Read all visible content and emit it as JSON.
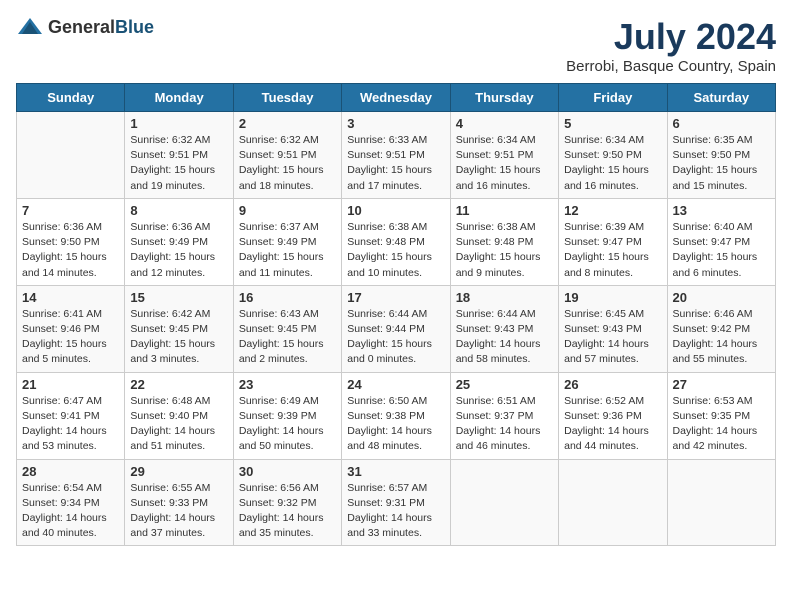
{
  "logo": {
    "general": "General",
    "blue": "Blue"
  },
  "title": "July 2024",
  "location": "Berrobi, Basque Country, Spain",
  "days_header": [
    "Sunday",
    "Monday",
    "Tuesday",
    "Wednesday",
    "Thursday",
    "Friday",
    "Saturday"
  ],
  "weeks": [
    [
      {
        "day": "",
        "info": ""
      },
      {
        "day": "1",
        "info": "Sunrise: 6:32 AM\nSunset: 9:51 PM\nDaylight: 15 hours and 19 minutes."
      },
      {
        "day": "2",
        "info": "Sunrise: 6:32 AM\nSunset: 9:51 PM\nDaylight: 15 hours and 18 minutes."
      },
      {
        "day": "3",
        "info": "Sunrise: 6:33 AM\nSunset: 9:51 PM\nDaylight: 15 hours and 17 minutes."
      },
      {
        "day": "4",
        "info": "Sunrise: 6:34 AM\nSunset: 9:51 PM\nDaylight: 15 hours and 16 minutes."
      },
      {
        "day": "5",
        "info": "Sunrise: 6:34 AM\nSunset: 9:50 PM\nDaylight: 15 hours and 16 minutes."
      },
      {
        "day": "6",
        "info": "Sunrise: 6:35 AM\nSunset: 9:50 PM\nDaylight: 15 hours and 15 minutes."
      }
    ],
    [
      {
        "day": "7",
        "info": "Sunrise: 6:36 AM\nSunset: 9:50 PM\nDaylight: 15 hours and 14 minutes."
      },
      {
        "day": "8",
        "info": "Sunrise: 6:36 AM\nSunset: 9:49 PM\nDaylight: 15 hours and 12 minutes."
      },
      {
        "day": "9",
        "info": "Sunrise: 6:37 AM\nSunset: 9:49 PM\nDaylight: 15 hours and 11 minutes."
      },
      {
        "day": "10",
        "info": "Sunrise: 6:38 AM\nSunset: 9:48 PM\nDaylight: 15 hours and 10 minutes."
      },
      {
        "day": "11",
        "info": "Sunrise: 6:38 AM\nSunset: 9:48 PM\nDaylight: 15 hours and 9 minutes."
      },
      {
        "day": "12",
        "info": "Sunrise: 6:39 AM\nSunset: 9:47 PM\nDaylight: 15 hours and 8 minutes."
      },
      {
        "day": "13",
        "info": "Sunrise: 6:40 AM\nSunset: 9:47 PM\nDaylight: 15 hours and 6 minutes."
      }
    ],
    [
      {
        "day": "14",
        "info": "Sunrise: 6:41 AM\nSunset: 9:46 PM\nDaylight: 15 hours and 5 minutes."
      },
      {
        "day": "15",
        "info": "Sunrise: 6:42 AM\nSunset: 9:45 PM\nDaylight: 15 hours and 3 minutes."
      },
      {
        "day": "16",
        "info": "Sunrise: 6:43 AM\nSunset: 9:45 PM\nDaylight: 15 hours and 2 minutes."
      },
      {
        "day": "17",
        "info": "Sunrise: 6:44 AM\nSunset: 9:44 PM\nDaylight: 15 hours and 0 minutes."
      },
      {
        "day": "18",
        "info": "Sunrise: 6:44 AM\nSunset: 9:43 PM\nDaylight: 14 hours and 58 minutes."
      },
      {
        "day": "19",
        "info": "Sunrise: 6:45 AM\nSunset: 9:43 PM\nDaylight: 14 hours and 57 minutes."
      },
      {
        "day": "20",
        "info": "Sunrise: 6:46 AM\nSunset: 9:42 PM\nDaylight: 14 hours and 55 minutes."
      }
    ],
    [
      {
        "day": "21",
        "info": "Sunrise: 6:47 AM\nSunset: 9:41 PM\nDaylight: 14 hours and 53 minutes."
      },
      {
        "day": "22",
        "info": "Sunrise: 6:48 AM\nSunset: 9:40 PM\nDaylight: 14 hours and 51 minutes."
      },
      {
        "day": "23",
        "info": "Sunrise: 6:49 AM\nSunset: 9:39 PM\nDaylight: 14 hours and 50 minutes."
      },
      {
        "day": "24",
        "info": "Sunrise: 6:50 AM\nSunset: 9:38 PM\nDaylight: 14 hours and 48 minutes."
      },
      {
        "day": "25",
        "info": "Sunrise: 6:51 AM\nSunset: 9:37 PM\nDaylight: 14 hours and 46 minutes."
      },
      {
        "day": "26",
        "info": "Sunrise: 6:52 AM\nSunset: 9:36 PM\nDaylight: 14 hours and 44 minutes."
      },
      {
        "day": "27",
        "info": "Sunrise: 6:53 AM\nSunset: 9:35 PM\nDaylight: 14 hours and 42 minutes."
      }
    ],
    [
      {
        "day": "28",
        "info": "Sunrise: 6:54 AM\nSunset: 9:34 PM\nDaylight: 14 hours and 40 minutes."
      },
      {
        "day": "29",
        "info": "Sunrise: 6:55 AM\nSunset: 9:33 PM\nDaylight: 14 hours and 37 minutes."
      },
      {
        "day": "30",
        "info": "Sunrise: 6:56 AM\nSunset: 9:32 PM\nDaylight: 14 hours and 35 minutes."
      },
      {
        "day": "31",
        "info": "Sunrise: 6:57 AM\nSunset: 9:31 PM\nDaylight: 14 hours and 33 minutes."
      },
      {
        "day": "",
        "info": ""
      },
      {
        "day": "",
        "info": ""
      },
      {
        "day": "",
        "info": ""
      }
    ]
  ]
}
